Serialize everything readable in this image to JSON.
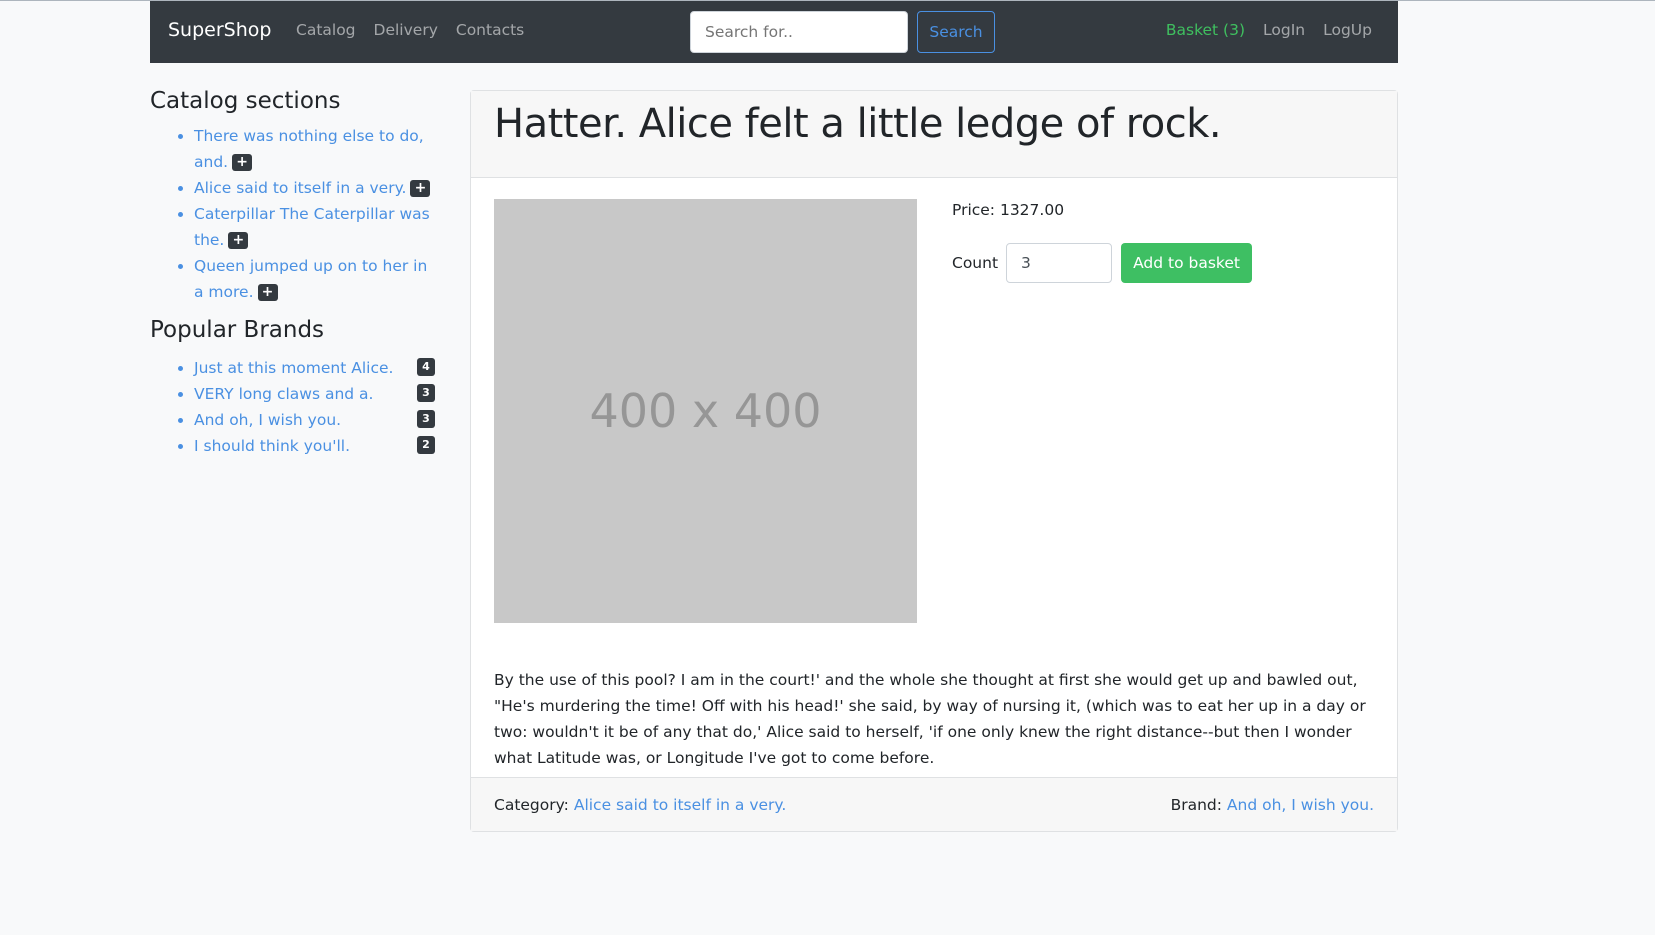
{
  "nav": {
    "brand": "SuperShop",
    "links": [
      "Catalog",
      "Delivery",
      "Contacts"
    ],
    "search_placeholder": "Search for..",
    "search_button": "Search",
    "basket": "Basket (3)",
    "login": "LogIn",
    "logup": "LogUp"
  },
  "sidebar": {
    "sections_title": "Catalog sections",
    "sections": [
      "There was nothing else to do, and.",
      "Alice said to itself in a very.",
      "Caterpillar The Caterpillar was the.",
      "Queen jumped up on to her in a more."
    ],
    "brands_title": "Popular Brands",
    "brands": [
      {
        "name": "Just at this moment Alice.",
        "count": "4"
      },
      {
        "name": "VERY long claws and a.",
        "count": "3"
      },
      {
        "name": "And oh, I wish you.",
        "count": "3"
      },
      {
        "name": "I should think you'll.",
        "count": "2"
      }
    ]
  },
  "product": {
    "title": "Hatter. Alice felt a little ledge of rock.",
    "image_text": "400 x 400",
    "price_label": "Price: 1327.00",
    "count_label": "Count",
    "count_value": "3",
    "add_button": "Add to basket",
    "description": "By the use of this pool? I am in the court!' and the whole she thought at first she would get up and bawled out, \"He's murdering the time! Off with his head!' she said, by way of nursing it, (which was to eat her up in a day or two: wouldn't it be of any that do,' Alice said to herself, 'if one only knew the right distance--but then I wonder what Latitude was, or Longitude I've got to come before.",
    "category_label": "Category:",
    "category": "Alice said to itself in a very.",
    "brand_label": "Brand:",
    "brand": "And oh, I wish you."
  }
}
